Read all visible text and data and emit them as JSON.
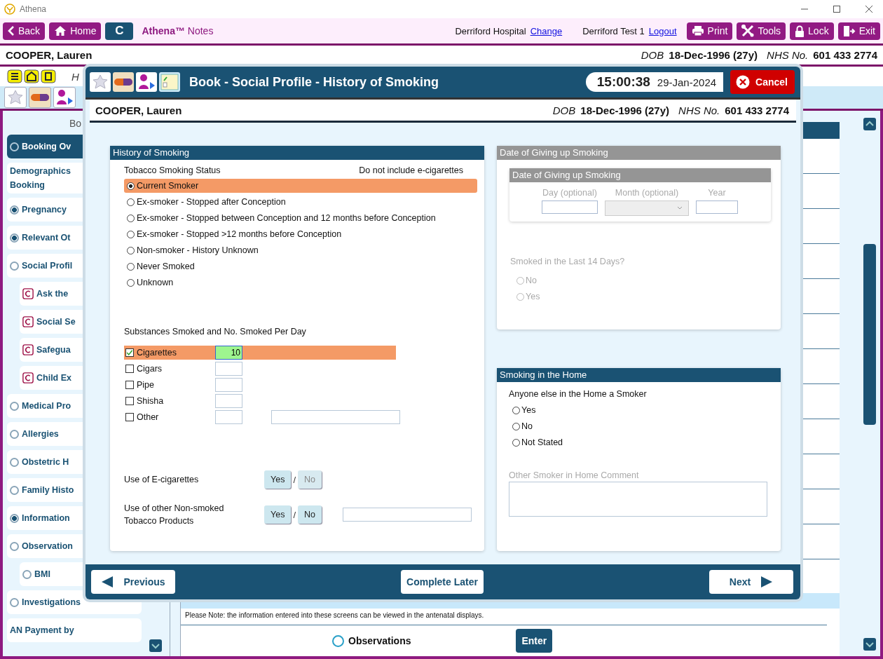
{
  "window": {
    "title": "Athena"
  },
  "toolbar": {
    "left_buttons": [
      {
        "label": "Back",
        "kind": "back"
      },
      {
        "label": "Home",
        "kind": "home"
      }
    ],
    "c_button": "C",
    "app_name": "**Athena™** Notes",
    "site": "Derriford Hospital",
    "site_link": "Change",
    "user": "Derriford Test 1",
    "user_link": "Logout",
    "right_buttons": [
      {
        "label": "Print",
        "kind": "print"
      },
      {
        "label": "Tools",
        "kind": "tools"
      },
      {
        "label": "Lock",
        "kind": "lock"
      },
      {
        "label": "Exit",
        "kind": "exit"
      }
    ]
  },
  "patient": {
    "name": "COOPER, Lauren",
    "dob_label": "DOB",
    "dob": "18-Dec-1996 (27y)",
    "nhs_label": "NHS No.",
    "nhs": "601 433 2774"
  },
  "help_row": {
    "title": "H"
  },
  "sidebar": {
    "heading": "Bo",
    "items": [
      {
        "label": "Booking Ov",
        "kind": "radio",
        "checked": false,
        "selected": true
      },
      {
        "label": "Demographics\nBooking",
        "kind": "plain",
        "selected": false
      },
      {
        "label": "Pregnancy",
        "kind": "radio",
        "checked": true,
        "selected": false
      },
      {
        "label": "Relevant Ot",
        "kind": "radio",
        "checked": true,
        "selected": false
      },
      {
        "label": "Social Profil",
        "kind": "radio",
        "checked": false,
        "selected": false,
        "children": [
          {
            "label": "Ask the",
            "kind": "c-icon",
            "selected": false
          },
          {
            "label": "Social Se",
            "kind": "c-icon",
            "selected": false
          },
          {
            "label": "Safegua",
            "kind": "c-icon",
            "selected": false
          },
          {
            "label": "Child Ex",
            "kind": "c-icon",
            "selected": false
          }
        ]
      },
      {
        "label": "Medical Pro",
        "kind": "radio",
        "checked": false,
        "selected": false
      },
      {
        "label": "Allergies",
        "kind": "radio",
        "checked": false,
        "selected": false
      },
      {
        "label": "Obstetric H",
        "kind": "radio",
        "checked": false,
        "selected": false
      },
      {
        "label": "Family Histo",
        "kind": "radio",
        "checked": false,
        "selected": false
      },
      {
        "label": "Information",
        "kind": "radio",
        "checked": true,
        "selected": false
      },
      {
        "label": "Observation",
        "kind": "radio",
        "checked": false,
        "selected": false,
        "children": [
          {
            "label": "BMI",
            "kind": "radio",
            "checked": false,
            "selected": false
          }
        ]
      },
      {
        "label": "Investigations",
        "kind": "radio",
        "checked": false,
        "selected": false
      },
      {
        "label": "AN Payment by",
        "kind": "plain",
        "selected": false
      }
    ]
  },
  "background_content": {
    "note": "Please Note: the information entered into these screens can be viewed in the antenatal displays.",
    "observations": {
      "label": "Observations",
      "checked": false
    },
    "enter_button": "Enter"
  },
  "dialog": {
    "title": "Book - Social Profile - History of Smoking",
    "time": "15:00:38",
    "date": "29-Jan-2024",
    "cancel": "Cancel",
    "patient": {
      "name": "COOPER, Lauren",
      "dob_label": "DOB",
      "dob": "18-Dec-1996 (27y)",
      "nhs_label": "NHS No.",
      "nhs": "601 433 2774"
    },
    "history": {
      "title": "History of Smoking",
      "status_label": "Tobacco Smoking Status",
      "status_note": "Do not include e-cigarettes",
      "options": [
        {
          "label": "Current Smoker",
          "selected": true
        },
        {
          "label": "Ex-smoker - Stopped after Conception",
          "selected": false
        },
        {
          "label": "Ex-smoker - Stopped between Conception and 12 months before Conception",
          "selected": false
        },
        {
          "label": "Ex-smoker - Stopped >12 months before Conception",
          "selected": false
        },
        {
          "label": "Non-smoker - History Unknown",
          "selected": false
        },
        {
          "label": "Never Smoked",
          "selected": false
        },
        {
          "label": "Unknown",
          "selected": false
        }
      ],
      "substances_label": "Substances Smoked and No. Smoked Per Day",
      "substances": [
        {
          "label": "Cigarettes",
          "checked": true,
          "count": "10",
          "kind": "count"
        },
        {
          "label": "Cigars",
          "checked": false,
          "kind": "count"
        },
        {
          "label": "Pipe",
          "checked": false,
          "kind": "count"
        },
        {
          "label": "Shisha",
          "checked": false,
          "kind": "count"
        },
        {
          "label": "Other",
          "checked": false,
          "kind": "count-text"
        }
      ],
      "questions": [
        {
          "label": "Use of E-cigarettes",
          "kind": "toggle",
          "separator": "/",
          "options": [
            {
              "label": "Yes",
              "disabled": false
            },
            {
              "label": "No",
              "disabled": true
            }
          ]
        },
        {
          "label": "Use of other Non-smoked Tobacco Products",
          "kind": "toggle-text",
          "separator": "/",
          "options": [
            {
              "label": "Yes",
              "disabled": false
            },
            {
              "label": "No",
              "disabled": false
            }
          ]
        }
      ]
    },
    "giving_up": {
      "title": "Date of Giving up Smoking",
      "disabled": true,
      "inner_title": "Date of Giving up Smoking",
      "fields": [
        {
          "label": "Day (optional)",
          "kind": "text"
        },
        {
          "label": "Month (optional)",
          "kind": "select"
        },
        {
          "label": "Year",
          "kind": "year"
        }
      ],
      "question": "Smoked in the Last 14 Days?",
      "options": [
        {
          "label": "No",
          "selected": false
        },
        {
          "label": "Yes",
          "selected": false
        }
      ]
    },
    "home": {
      "title": "Smoking in the Home",
      "question": "Anyone else in the Home a Smoker",
      "options": [
        {
          "label": "Yes",
          "selected": false
        },
        {
          "label": "No",
          "selected": false
        },
        {
          "label": "Not Stated",
          "selected": false
        }
      ],
      "comment_label": "Other Smoker in Home Comment"
    },
    "footer": {
      "previous": "Previous",
      "complete_later": "Complete Later",
      "next": "Next"
    }
  }
}
